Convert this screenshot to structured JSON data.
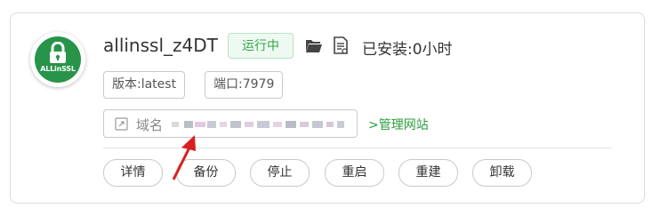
{
  "app": {
    "name": "allinssl_z4DT",
    "status": "运行中",
    "installed_label": "已安装:0小时",
    "logo_text": "ALLinSSL",
    "version_tag": "版本:latest",
    "port_tag": "端口:7979",
    "domain_label": "域名",
    "domain_value": "",
    "manage_link": ">管理网站",
    "colors": {
      "accent": "#2a9c3c",
      "logo_bg": "#27944a",
      "badge_bg": "#eefaf1"
    }
  },
  "actions": {
    "details": "详情",
    "backup": "备份",
    "stop": "停止",
    "restart": "重启",
    "rebuild": "重建",
    "uninstall": "卸载"
  },
  "icons": [
    "lock-icon",
    "folder-icon",
    "document-icon",
    "external-link-icon",
    "red-arrow-annotation"
  ]
}
